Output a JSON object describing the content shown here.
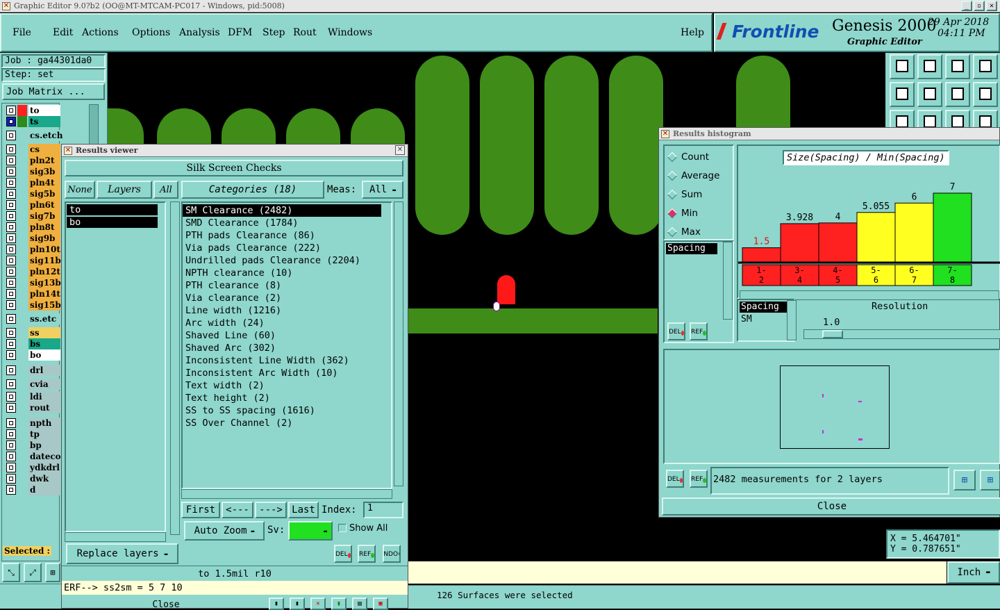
{
  "window": {
    "title": "Graphic Editor 9.0?b2 (OO@MT-MTCAM-PC017 - Windows, pid:5008)"
  },
  "menu": [
    "File",
    "Edit",
    "Actions",
    "Options",
    "Analysis",
    "DFM",
    "Step",
    "Rout",
    "Windows"
  ],
  "help": "Help",
  "brand": {
    "logo": "Frontline",
    "product": "Genesis 2000",
    "subtitle": "Graphic Editor",
    "date": "29 Apr 2018",
    "time": "04:11 PM"
  },
  "job": {
    "job": "Job : ga44301da0",
    "step": "Step: set",
    "matrix": "Job Matrix ..."
  },
  "layers": [
    {
      "name": "to",
      "color": "#ff2020",
      "box": "#fff"
    },
    {
      "name": "ts",
      "color": "#2e8a1a",
      "box": "#19a88a"
    },
    {
      "name": "cs.etch",
      "color": "",
      "box": "#8fd6cc"
    },
    {
      "name": "cs",
      "color": "",
      "box": "#f0b040"
    },
    {
      "name": "pln2t",
      "color": "",
      "box": "#f0b040"
    },
    {
      "name": "sig3b",
      "color": "",
      "box": "#f0b040"
    },
    {
      "name": "pln4t",
      "color": "",
      "box": "#f0b040"
    },
    {
      "name": "sig5b",
      "color": "",
      "box": "#f0b040"
    },
    {
      "name": "pln6t",
      "color": "",
      "box": "#f0b040"
    },
    {
      "name": "sig7b",
      "color": "",
      "box": "#f0b040"
    },
    {
      "name": "pln8t",
      "color": "",
      "box": "#f0b040"
    },
    {
      "name": "sig9b",
      "color": "",
      "box": "#f0b040"
    },
    {
      "name": "pln10t",
      "color": "",
      "box": "#f0b040"
    },
    {
      "name": "sig11b",
      "color": "",
      "box": "#f0b040"
    },
    {
      "name": "pln12t",
      "color": "",
      "box": "#f0b040"
    },
    {
      "name": "sig13b",
      "color": "",
      "box": "#f0b040"
    },
    {
      "name": "pln14t",
      "color": "",
      "box": "#f0b040"
    },
    {
      "name": "sig15b",
      "color": "",
      "box": "#f0b040"
    },
    {
      "name": "ss.etc",
      "color": "",
      "box": "#8fd6cc"
    },
    {
      "name": "ss",
      "color": "",
      "box": "#f0d060"
    },
    {
      "name": "bs",
      "color": "",
      "box": "#19a88a"
    },
    {
      "name": "bo",
      "color": "",
      "box": "#fff"
    },
    {
      "name": "drl",
      "color": "",
      "box": "#a8c8c8"
    },
    {
      "name": "cvia",
      "color": "",
      "box": "#a8c8c8"
    },
    {
      "name": "ldi",
      "color": "",
      "box": "#a8c8c8"
    },
    {
      "name": "rout",
      "color": "",
      "box": "#a8c8c8"
    },
    {
      "name": "npth",
      "color": "",
      "box": "#a8c8c8"
    },
    {
      "name": "tp",
      "color": "",
      "box": "#a8c8c8"
    },
    {
      "name": "bp",
      "color": "",
      "box": "#a8c8c8"
    },
    {
      "name": "dateco",
      "color": "",
      "box": "#a8c8c8"
    },
    {
      "name": "ydkdrl",
      "color": "",
      "box": "#a8c8c8"
    },
    {
      "name": "dwk",
      "color": "",
      "box": "#a8c8c8"
    },
    {
      "name": "d",
      "color": "",
      "box": "#a8c8c8"
    }
  ],
  "selected_label": "Selected :",
  "results_viewer": {
    "title": "Results viewer",
    "header": "Silk Screen Checks",
    "none": "None",
    "layers": "Layers",
    "all": "All",
    "categories_btn": "Categories (18)",
    "meas_label": "Meas:",
    "meas_value": "All",
    "layer_list": [
      "to",
      "bo"
    ],
    "categories": [
      "SM Clearance (2482)",
      "SMD Clearance (1784)",
      "PTH pads Clearance (86)",
      "Via pads Clearance (222)",
      "Undrilled pads Clearance (2204)",
      "NPTH clearance (10)",
      "PTH clearance (8)",
      "Via clearance (2)",
      "Line width (1216)",
      "Arc width (24)",
      "Shaved Line (60)",
      "Shaved Arc (302)",
      "Inconsistent Line Width (362)",
      "Inconsistent Arc Width (10)",
      "Text width (2)",
      "Text height (2)",
      "SS to SS spacing (1616)",
      "SS Over Channel (2)"
    ],
    "nav": {
      "first": "First",
      "prev": "<---",
      "next": "--->",
      "last": "Last",
      "index_label": "Index:",
      "index_value": "1"
    },
    "auto_zoom": "Auto Zoom",
    "sv_label": "Sv:",
    "show_all": "Show All",
    "replace_layers": "Replace layers",
    "icons": [
      "DEL",
      "REF",
      "UNDO"
    ],
    "status": "to 1.5mil r10",
    "erf": "ERF--> ss2sm = 5 7 10",
    "close": "Close"
  },
  "histogram": {
    "title": "Results histogram",
    "radios": [
      {
        "label": "Count",
        "on": false
      },
      {
        "label": "Average",
        "on": false
      },
      {
        "label": "Sum",
        "on": false
      },
      {
        "label": "Min",
        "on": true
      },
      {
        "label": "Max",
        "on": false
      }
    ],
    "chart_title": "Size(Spacing) / Min(Spacing)",
    "measure_list": [
      "Spacing"
    ],
    "bins_list": [
      "Spacing",
      "SM"
    ],
    "resolution_label": "Resolution",
    "resolution_value": "1.0",
    "summary": "2482 measurements for 2 layers",
    "close": "Close",
    "icons": [
      "DEL",
      "REF"
    ]
  },
  "chart_data": {
    "type": "bar",
    "categories": [
      "1-2",
      "3-4",
      "4-5",
      "5-6",
      "6-7",
      "7-8"
    ],
    "values": [
      1.5,
      3.928,
      4,
      5.055,
      6,
      7
    ],
    "value_labels": [
      "1.5",
      "3.928",
      "4",
      "5.055",
      "6",
      "7"
    ],
    "colors": [
      "#ff2020",
      "#ff2020",
      "#ff2020",
      "#ffff20",
      "#ffff20",
      "#20e020"
    ],
    "title": "Size(Spacing) / Min(Spacing)",
    "ylim": [
      0,
      8.4
    ]
  },
  "coords": {
    "x": "X = 5.464701\"",
    "y": "Y = 0.787651\""
  },
  "units": "Inch",
  "status_bar": "126 Surfaces were selected"
}
